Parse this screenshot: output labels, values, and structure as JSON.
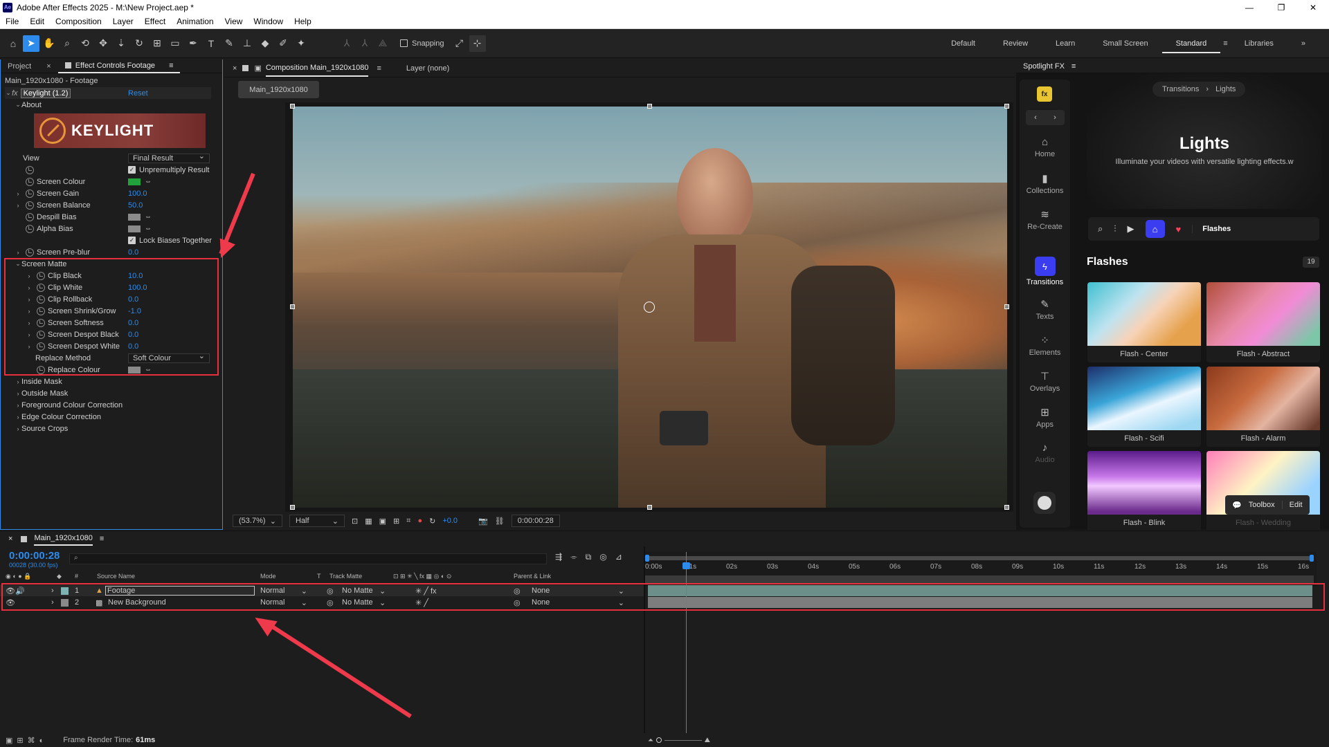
{
  "window": {
    "title": "Adobe After Effects 2025 - M:\\New Project.aep *",
    "logo": "Ae"
  },
  "menu": [
    "File",
    "Edit",
    "Composition",
    "Layer",
    "Effect",
    "Animation",
    "View",
    "Window",
    "Help"
  ],
  "toolbar": {
    "snapping_label": "Snapping",
    "workspaces": [
      "Default",
      "Review",
      "Learn",
      "Small Screen",
      "Standard",
      "Libraries"
    ],
    "active_workspace": "Standard"
  },
  "left_panel": {
    "tabs": [
      "Project",
      "Effect Controls Footage"
    ],
    "header": "Main_1920x1080 - Footage",
    "effect_name": "Keylight (1.2)",
    "reset_label": "Reset",
    "about_label": "About",
    "logo_text": "KEYLIGHT",
    "view_label": "View",
    "view_value": "Final Result",
    "unpremultiply_label": "Unpremultiply Result",
    "screen_colour_label": "Screen Colour",
    "screen_colour": "#1fa33a",
    "screen_gain_label": "Screen Gain",
    "screen_gain": "100.0",
    "screen_balance_label": "Screen Balance",
    "screen_balance": "50.0",
    "despill_bias_label": "Despill Bias",
    "alpha_bias_label": "Alpha Bias",
    "lock_biases_label": "Lock Biases Together",
    "screen_preblur_label": "Screen Pre-blur",
    "screen_preblur": "0.0",
    "screen_matte_label": "Screen Matte",
    "matte_rows": [
      {
        "label": "Clip Black",
        "value": "10.0"
      },
      {
        "label": "Clip White",
        "value": "100.0"
      },
      {
        "label": "Clip Rollback",
        "value": "0.0"
      },
      {
        "label": "Screen Shrink/Grow",
        "value": "-1.0"
      },
      {
        "label": "Screen Softness",
        "value": "0.0"
      },
      {
        "label": "Screen Despot Black",
        "value": "0.0"
      },
      {
        "label": "Screen Despot White",
        "value": "0.0"
      }
    ],
    "replace_method_label": "Replace Method",
    "replace_method_value": "Soft Colour",
    "replace_colour_label": "Replace Colour",
    "groups": [
      "Inside Mask",
      "Outside Mask",
      "Foreground Colour Correction",
      "Edge Colour Correction",
      "Source Crops"
    ]
  },
  "viewer": {
    "tab_label": "Composition Main_1920x1080",
    "layer_label": "Layer (none)",
    "comp_button": "Main_1920x1080",
    "zoom": "(53.7%)",
    "resolution": "Half",
    "exposure": "+0.0",
    "timecode": "0:00:00:28"
  },
  "spotlight": {
    "title": "Spotlight FX",
    "breadcrumb": [
      "Transitions",
      "Lights"
    ],
    "hero_title": "Lights",
    "hero_subtitle": "Illuminate your videos with versatile lighting effects.w",
    "nav": [
      "Home",
      "Collections",
      "Re-Create",
      "Transitions",
      "Texts",
      "Elements",
      "Overlays",
      "Apps",
      "Audio"
    ],
    "active_nav": "Transitions",
    "filter_label": "Flashes",
    "section_title": "Flashes",
    "count": "19",
    "thumbs": [
      "Flash - Center",
      "Flash - Abstract",
      "Flash - Scifi",
      "Flash - Alarm",
      "Flash - Blink",
      "Flash - Wedding"
    ],
    "toolbox_label": "Toolbox",
    "edit_label": "Edit"
  },
  "timeline": {
    "comp_name": "Main_1920x1080",
    "timecode": "0:00:00:28",
    "frame_info": "00028 (30.00 fps)",
    "headers": [
      "Source Name",
      "Mode",
      "T",
      "Track Matte",
      "Parent & Link"
    ],
    "ruler": [
      "0:00s",
      "01s",
      "02s",
      "03s",
      "04s",
      "05s",
      "06s",
      "07s",
      "08s",
      "09s",
      "10s",
      "11s",
      "12s",
      "13s",
      "14s",
      "15s",
      "16s"
    ],
    "layers": [
      {
        "num": "1",
        "name": "Footage",
        "mode": "Normal",
        "matte": "No Matte",
        "parent": "None"
      },
      {
        "num": "2",
        "name": "New Background",
        "mode": "Normal",
        "matte": "No Matte",
        "parent": "None"
      }
    ]
  },
  "status": {
    "render_label": "Frame Render Time:",
    "render_value": "61ms"
  }
}
